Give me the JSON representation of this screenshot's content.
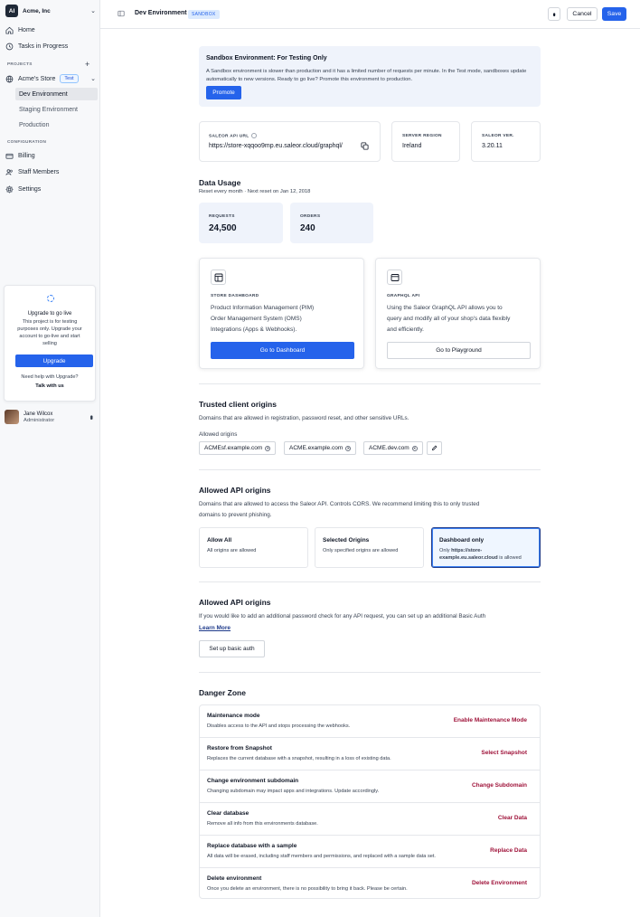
{
  "sidebar": {
    "org_logo": "AI",
    "org_name": "Acme, Inc",
    "nav": [
      {
        "label": "Home",
        "icon": "home-icon"
      },
      {
        "label": "Tasks in Progress",
        "icon": "tasks-icon"
      }
    ],
    "projects_header": "PROJECTS",
    "project_name": "Acme's Store",
    "project_badge": "Test",
    "environments": [
      "Dev Environment",
      "Staging Environment",
      "Production"
    ],
    "config_header": "CONFIGURATION",
    "config": [
      {
        "label": "Billing",
        "icon": "billing-icon"
      },
      {
        "label": "Staff Members",
        "icon": "staff-icon"
      },
      {
        "label": "Settings",
        "icon": "settings-icon"
      }
    ],
    "upgrade": {
      "title": "Upgrade to go live",
      "desc": "This project is for testing purposes only. Upgrade your account to go-live and start selling",
      "button": "Upgrade",
      "help": "Need help with Upgrade?",
      "talk": "Talk with us"
    },
    "user": {
      "name": "Jane Wilcox",
      "role": "Administrator"
    }
  },
  "topbar": {
    "title": "Dev Environment",
    "badge": "SANDBOX",
    "cancel": "Cancel",
    "save": "Save"
  },
  "banner": {
    "title": "Sandbox Environment: For Testing Only",
    "text": "A Sandbox environment is slower than production and it has a limited number of requests per minute. In the Test mode, sandboxes update automatically to new versions. Ready to go live? Promote this environment to production.",
    "button": "Promote"
  },
  "info": {
    "api_label": "SALEOR API URL",
    "api_value": "https://store-xqqoo9mp.eu.saleor.cloud/graphql/",
    "region_label": "SERVER REGION",
    "region_value": "Ireland",
    "ver_label": "SALEOR VER.",
    "ver_value": "3.20.11"
  },
  "usage": {
    "title": "Data Usage",
    "subtitle": "Reset every month · Next reset on Jan 12, 2018",
    "requests_label": "REQUESTS",
    "requests_value": "24,500",
    "orders_label": "ORDERS",
    "orders_value": "240"
  },
  "features": {
    "store": {
      "label": "STORE DASHBOARD",
      "lines": [
        "Product Information Management (PIM)",
        "Order Management System (OMS)",
        "Integrations (Apps & Webhooks)."
      ],
      "button": "Go to Dashboard"
    },
    "graphql": {
      "label": "GRAPHQL API",
      "lines": [
        "Using the Saleor GraphQL API allows you to",
        "query and modify all of your shop's data flexibly",
        "and efficiently."
      ],
      "button": "Go to Playground"
    }
  },
  "trusted": {
    "title": "Trusted client origins",
    "desc": "Domains that are allowed in registration, password reset, and other sensitive URLs.",
    "allowed_label": "Allowed origins",
    "origins": [
      "ACMEsf.example.com",
      "ACME.example.com",
      "ACME.dev.com"
    ]
  },
  "api_origins": {
    "title": "Allowed API origins",
    "desc": [
      "Domains that are allowed to access the Saleor API. Controls CORS. We recommend limiting this to only trusted",
      "domains to prevent phishing."
    ],
    "options": [
      {
        "title": "Allow All",
        "desc": "All origins are allowed"
      },
      {
        "title": "Selected Origins",
        "desc": "Only specified origins are allowed"
      },
      {
        "title": "Dashboard only",
        "desc_prefix": "Only ",
        "desc_bold": "https://store-example.eu.saleor.cloud",
        "desc_suffix": " is allowed"
      }
    ]
  },
  "basic_auth": {
    "title": "Allowed API origins",
    "desc": "If you would like to add an additional password check for any API request, you can set up an additional Basic Auth",
    "link": "Learn More",
    "button": "Set up basic auth"
  },
  "danger": {
    "title": "Danger Zone",
    "rows": [
      {
        "title": "Maintenance mode",
        "desc": "Disables access to the API and stops processing the webhooks.",
        "action": "Enable Maintenance Mode"
      },
      {
        "title": "Restore from Snapshot",
        "desc": "Replaces the current database with a snapshot, resulting in a loss of existing data.",
        "action": "Select Snapshot"
      },
      {
        "title": "Change environment subdomain",
        "desc": "Changing subdomain may impact apps and integrations. Update accordingly.",
        "action": "Change Subdomain"
      },
      {
        "title": "Clear database",
        "desc": "Remove all info from this environments database.",
        "action": "Clear Data"
      },
      {
        "title": "Replace database with a sample",
        "desc": "All data will be erased, including staff members and permissions, and replaced with a sample data set.",
        "action": "Replace Data"
      },
      {
        "title": "Delete environment",
        "desc": "Once you delete an environment, there is no possibility to bring it back. Please be certain.",
        "action": "Delete Environment"
      }
    ]
  }
}
